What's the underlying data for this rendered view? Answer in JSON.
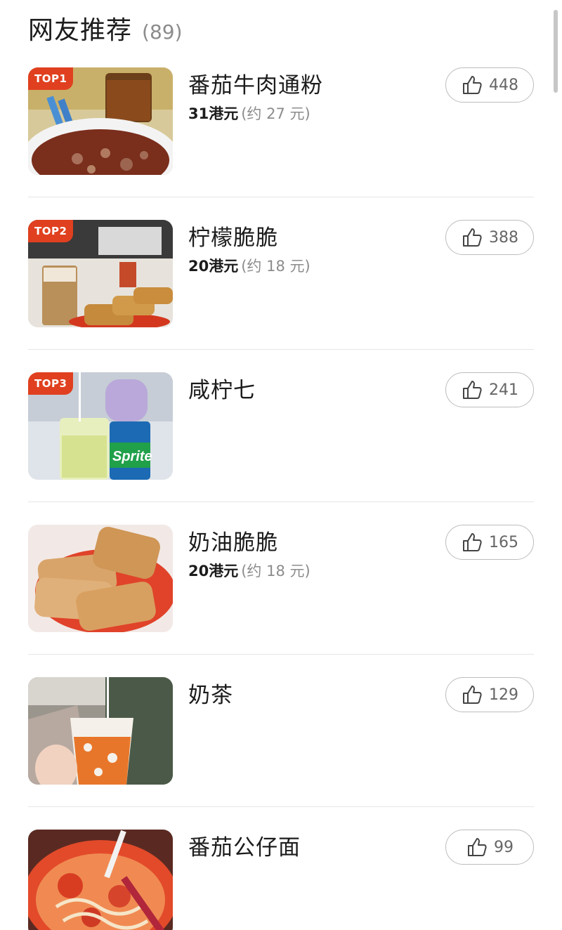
{
  "header": {
    "title": "网友推荐",
    "count": "(89)"
  },
  "items": [
    {
      "title": "番茄牛肉通粉",
      "badge": "TOP1",
      "price_main": "31港元",
      "price_approx": "(约 27 元)",
      "likes": "448",
      "thumb": "beef-macaroni-soup-photo"
    },
    {
      "title": "柠檬脆脆",
      "badge": "TOP2",
      "price_main": "20港元",
      "price_approx": "(约 18 元)",
      "likes": "388",
      "thumb": "lemon-crispy-toast-photo"
    },
    {
      "title": "咸柠七",
      "badge": "TOP3",
      "price_main": "",
      "price_approx": "",
      "likes": "241",
      "thumb": "salted-lemon-sprite-photo"
    },
    {
      "title": "奶油脆脆",
      "badge": "",
      "price_main": "20港元",
      "price_approx": "(约 18 元)",
      "likes": "165",
      "thumb": "butter-crispy-toast-photo"
    },
    {
      "title": "奶茶",
      "badge": "",
      "price_main": "",
      "price_approx": "",
      "likes": "129",
      "thumb": "milk-tea-cup-photo"
    },
    {
      "title": "番茄公仔面",
      "badge": "",
      "price_main": "",
      "price_approx": "",
      "likes": "99",
      "thumb": "tomato-instant-noodles-photo"
    }
  ],
  "icons": {
    "like": "thumbs-up-icon"
  },
  "colors": {
    "badge": "#e0401f",
    "title": "#1c1c1c",
    "muted": "#8c8c8c",
    "divider": "#e6e6e6"
  }
}
